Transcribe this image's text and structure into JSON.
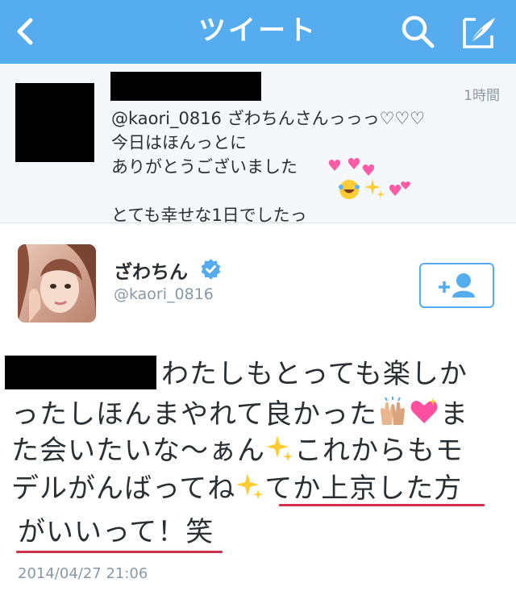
{
  "navbar": {
    "title": "ツイート",
    "back_icon": "chevron-left-icon",
    "search_icon": "search-icon",
    "compose_icon": "compose-icon",
    "color": "#55acee"
  },
  "context_tweet": {
    "time": "1時間",
    "text": "@kaori_0816 ざわちんさんっっっ♡♡♡\n今日はほんっとに\nありがとうございました\n\nとても幸せな1日でしたっ"
  },
  "tweet": {
    "name": "ざわちん",
    "handle": "@kaori_0816",
    "verified_icon": "verified-badge-icon",
    "follow_icon": "add-user-icon",
    "body_lines": [
      "わたしもとっても楽しか",
      "ったしほんまやれて良かった",
      "た会いたいな〜ぁん",
      "デルがんばってね",
      "がいいって！笑"
    ],
    "body_segments": {
      "line2_tail": "ま",
      "line3_tail": "これからもモ",
      "line4_tail": "てか上京した方"
    },
    "timestamp": "2014/04/27 21:06",
    "underline_color": "#d0314d"
  }
}
